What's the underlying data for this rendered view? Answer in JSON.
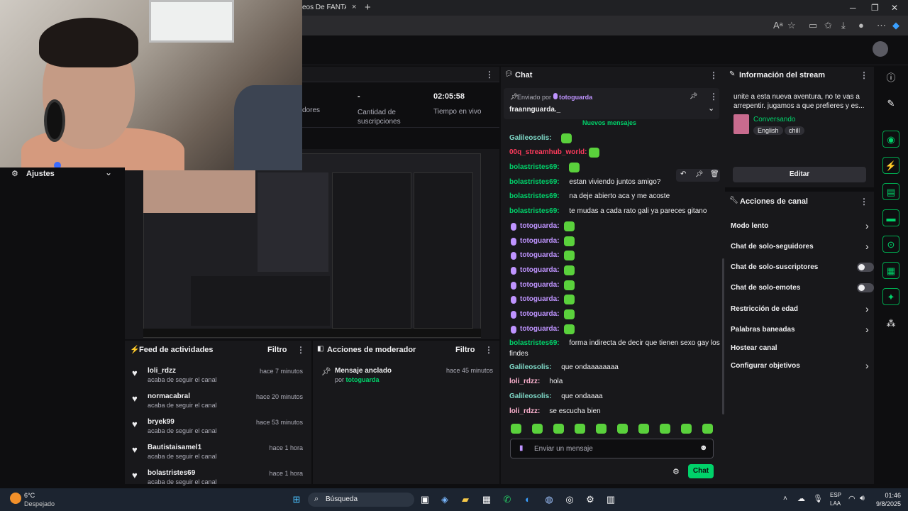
{
  "browser": {
    "tab_title": "eos De FANTASMA",
    "tab_close": "×",
    "tab_plus": "+",
    "window_min": "─",
    "window_max": "❐",
    "window_close": "✕"
  },
  "stats": {
    "item1_value": "",
    "item1_label": "dores",
    "item2_value": "-",
    "item2_label": "Cantidad de suscripciones",
    "item3_value": "02:05:58",
    "item3_label": "Tiempo en vivo"
  },
  "settings": {
    "title": "Ajustes"
  },
  "feed": {
    "title": "Feed de actividades",
    "filter": "Filtro",
    "items": [
      {
        "name": "loli_rdzz",
        "action": "acaba de seguir el canal",
        "time": "hace 7 minutos"
      },
      {
        "name": "normacabral",
        "action": "acaba de seguir el canal",
        "time": "hace 20 minutos"
      },
      {
        "name": "bryek99",
        "action": "acaba de seguir el canal",
        "time": "hace 53 minutos"
      },
      {
        "name": "Bautistaisamel1",
        "action": "acaba de seguir el canal",
        "time": "hace 1 hora"
      },
      {
        "name": "bolastristes69",
        "action": "acaba de seguir el canal",
        "time": "hace 1 hora"
      }
    ]
  },
  "mod": {
    "title": "Acciones de moderador",
    "filter": "Filtro",
    "pinned_title": "Mensaje anclado",
    "pinned_by": "por",
    "pinned_user": "totoguarda",
    "pinned_time": "hace 45 minutos"
  },
  "chat": {
    "title": "Chat",
    "pinned_sent_by": "Enviado por",
    "pinned_user": "totoguarda",
    "pinned_text": "fraannguarda._",
    "new_messages": "Nuevos mensajes",
    "messages": [
      {
        "user": "Galileosolis",
        "color": "#7fd9c8",
        "text": ""
      },
      {
        "user": "00q_streamhub_world",
        "color": "#ff3b5c",
        "text": ""
      },
      {
        "user": "bolastristes69",
        "color": "#00d26a",
        "text": ""
      },
      {
        "user": "bolastristes69",
        "color": "#00d26a",
        "text": "estan viviendo juntos amigo?"
      },
      {
        "user": "bolastristes69",
        "color": "#00d26a",
        "text": "na deje abierto aca y me acoste"
      },
      {
        "user": "bolastristes69",
        "color": "#00d26a",
        "text": "te mudas a cada rato gali ya pareces gitano"
      },
      {
        "user": "totoguarda",
        "color": "#bf94ff",
        "text": ""
      },
      {
        "user": "totoguarda",
        "color": "#bf94ff",
        "text": ""
      },
      {
        "user": "totoguarda",
        "color": "#bf94ff",
        "text": ""
      },
      {
        "user": "totoguarda",
        "color": "#bf94ff",
        "text": ""
      },
      {
        "user": "totoguarda",
        "color": "#bf94ff",
        "text": ""
      },
      {
        "user": "totoguarda",
        "color": "#bf94ff",
        "text": ""
      },
      {
        "user": "totoguarda",
        "color": "#bf94ff",
        "text": ""
      },
      {
        "user": "totoguarda",
        "color": "#bf94ff",
        "text": ""
      },
      {
        "user": "bolastristes69",
        "color": "#00d26a",
        "text": "forma indirecta de decir que tienen sexo gay los"
      },
      {
        "user": "",
        "color": "#efeff1",
        "text": "findes"
      },
      {
        "user": "Galileosolis",
        "color": "#7fd9c8",
        "text": "que ondaaaaaaaa"
      },
      {
        "user": "loli_rdzz",
        "color": "#ffb3d1",
        "text": "hola"
      },
      {
        "user": "Galileosolis",
        "color": "#7fd9c8",
        "text": "que ondaaaa"
      },
      {
        "user": "loli_rdzz",
        "color": "#ffb3d1",
        "text": "se escucha bien"
      }
    ],
    "input_placeholder": "Enviar un mensaje",
    "send_label": "Chat"
  },
  "info": {
    "title": "Información del stream",
    "stream_title": "unite a esta nueva aventura, no te vas a arrepentir. jugamos a que prefieres y es...",
    "category": "Conversando",
    "tags": [
      "English",
      "chill"
    ],
    "edit_label": "Editar"
  },
  "actions": {
    "title": "Acciones de canal",
    "items": [
      {
        "label": "Modo lento",
        "control": "chevron"
      },
      {
        "label": "Chat de solo-seguidores",
        "control": "chevron"
      },
      {
        "label": "Chat de solo-suscriptores",
        "control": "toggle"
      },
      {
        "label": "Chat de solo-emotes",
        "control": "toggle"
      },
      {
        "label": "Restricción de edad",
        "control": "chevron"
      },
      {
        "label": "Palabras baneadas",
        "control": "chevron"
      },
      {
        "label": "Hostear canal",
        "control": "none"
      },
      {
        "label": "Configurar objetivos",
        "control": "chevron"
      }
    ]
  },
  "taskbar": {
    "weather_temp": "6°C",
    "weather_desc": "Despejado",
    "search_label": "Búsqueda",
    "lang_top": "ESP",
    "lang_bottom": "LAA",
    "time": "01:46",
    "date": "9/8/2025"
  },
  "colors": {
    "accent": "#00d26a",
    "badge": "#bf94ff",
    "panel": "#18181b",
    "background": "#0e0e10"
  }
}
